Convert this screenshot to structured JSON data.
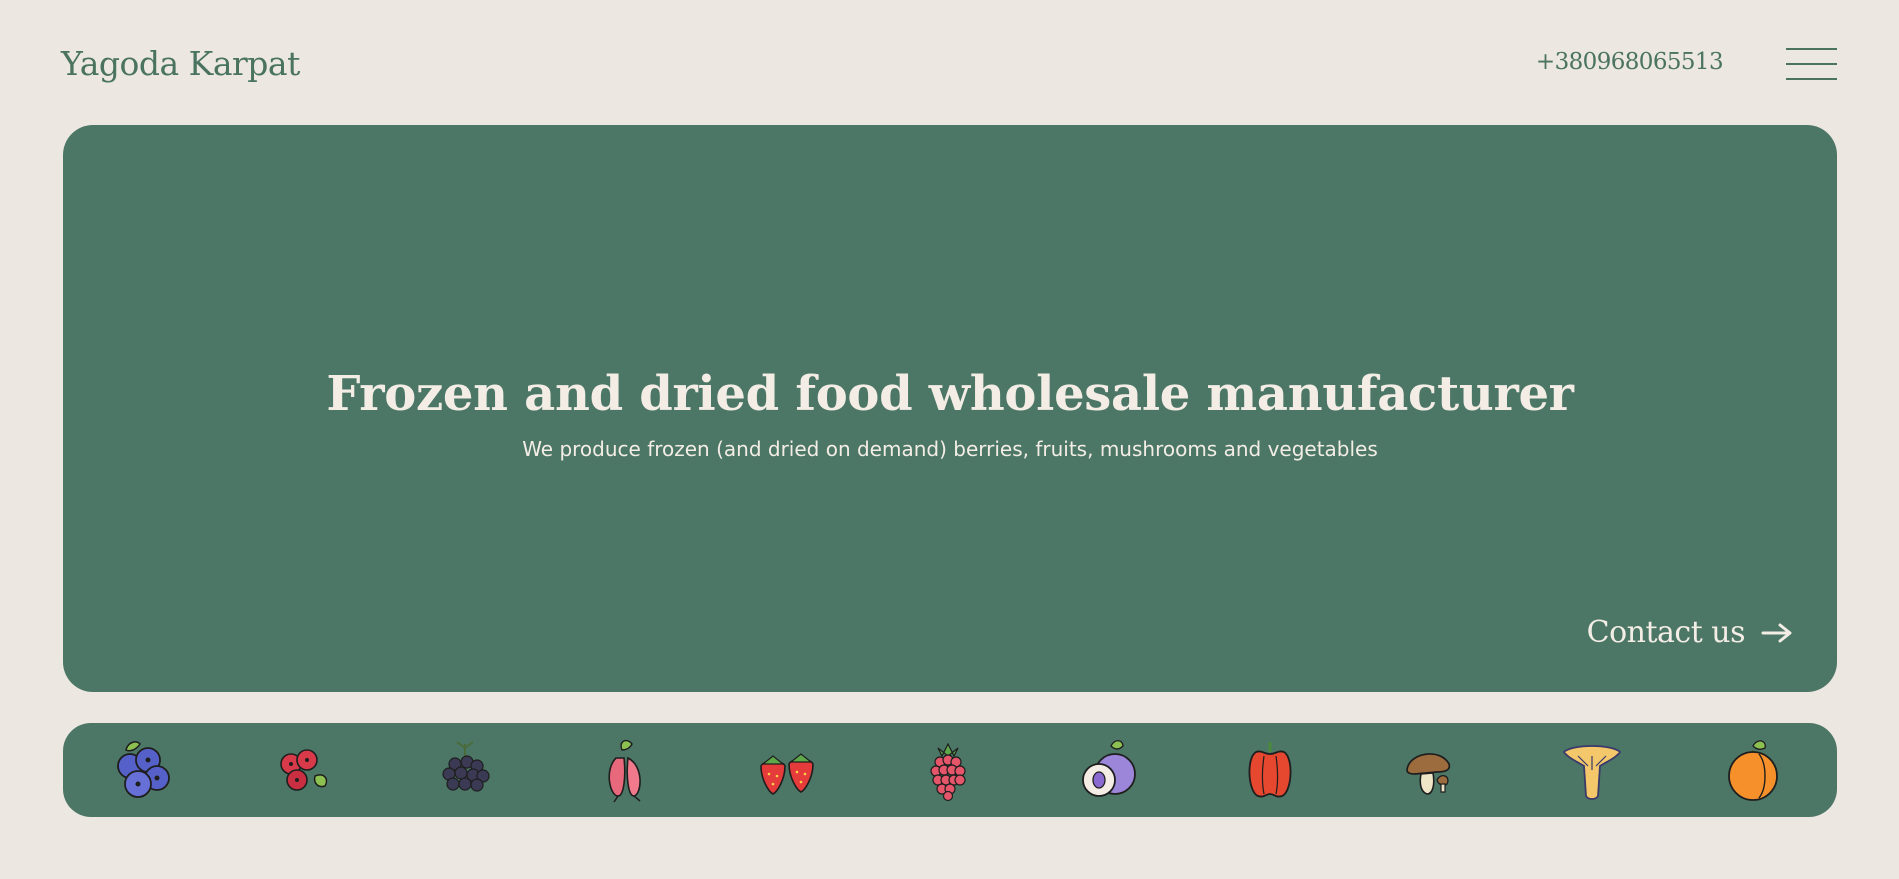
{
  "header": {
    "logo": "Yagoda Karpat",
    "phone": "+380968065513",
    "menu_icon": "hamburger-menu-icon"
  },
  "hero": {
    "title": "Frozen and dried food wholesale manufacturer",
    "subtitle": "We produce frozen (and dried on demand) berries, fruits, mushrooms and vegetables",
    "contact_label": "Contact us",
    "contact_icon": "arrow-right-icon"
  },
  "products": {
    "icons": [
      "blueberry-icon",
      "cranberry-icon",
      "elderberry-icon",
      "rosehip-icon",
      "strawberry-icon",
      "raspberry-icon",
      "plum-icon",
      "bell-pepper-icon",
      "porcini-mushroom-icon",
      "chanterelle-mushroom-icon",
      "apricot-icon"
    ]
  },
  "colors": {
    "page_background": "#ece7e1",
    "brand_green": "#4c7766",
    "text_green": "#4a7360",
    "light_text": "#f3ede6"
  }
}
